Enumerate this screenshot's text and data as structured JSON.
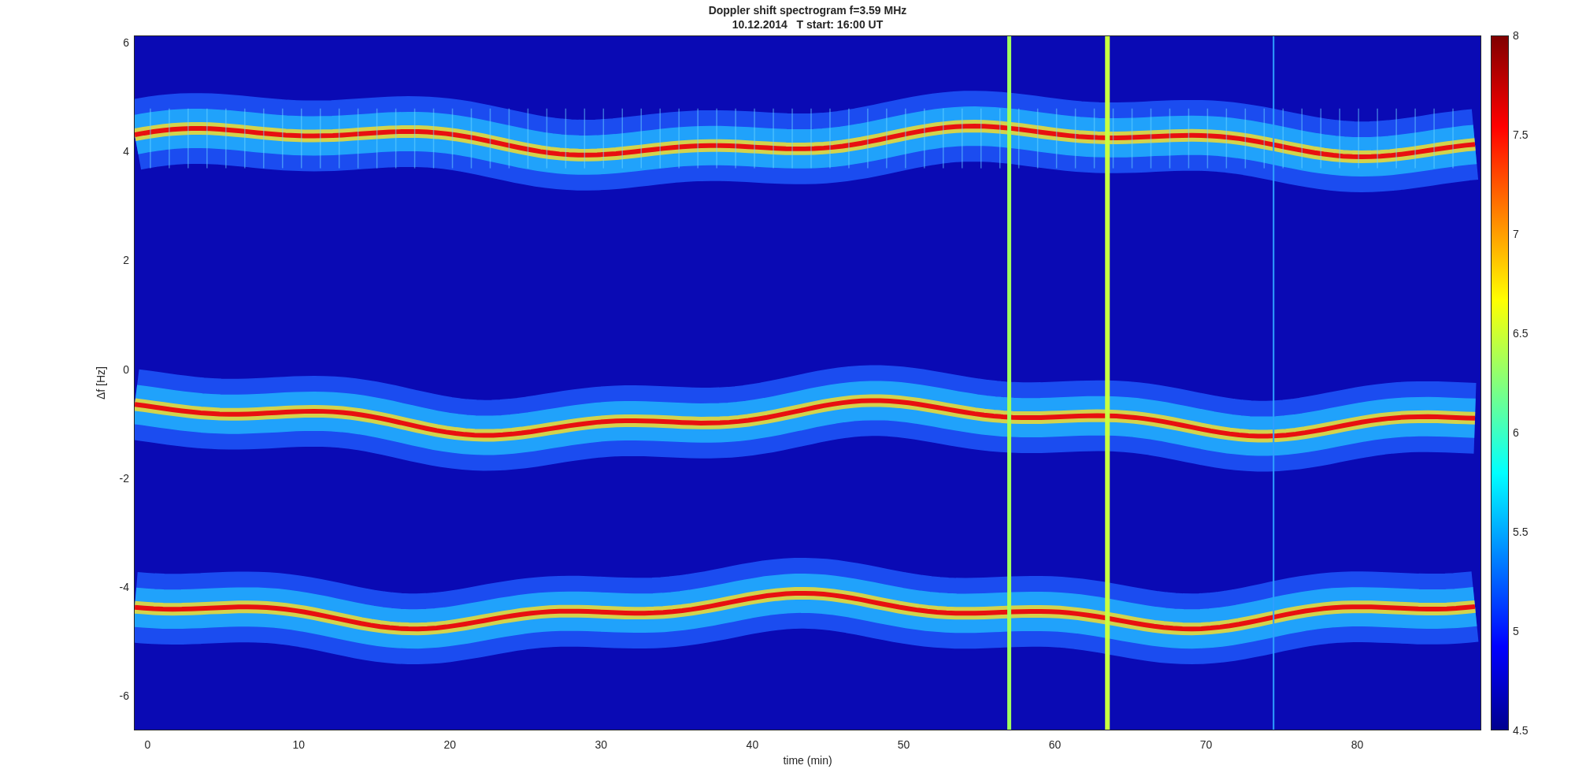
{
  "figure": {
    "title": "Doppler shift spectrogram f=3.59 MHz",
    "subtitle": "10.12.2014   T start: 16:00 UT",
    "xlabel": "time (min)",
    "ylabel": "Δf [Hz]",
    "xticks": [
      "0",
      "10",
      "20",
      "30",
      "40",
      "50",
      "60",
      "70",
      "80"
    ],
    "yticks": [
      "6",
      "4",
      "2",
      "0",
      "-2",
      "-4",
      "-6"
    ],
    "colorbar": {
      "ticks": [
        "8",
        "7.5",
        "7",
        "6.5",
        "6",
        "5.5",
        "5",
        "4.5"
      ]
    }
  }
}
